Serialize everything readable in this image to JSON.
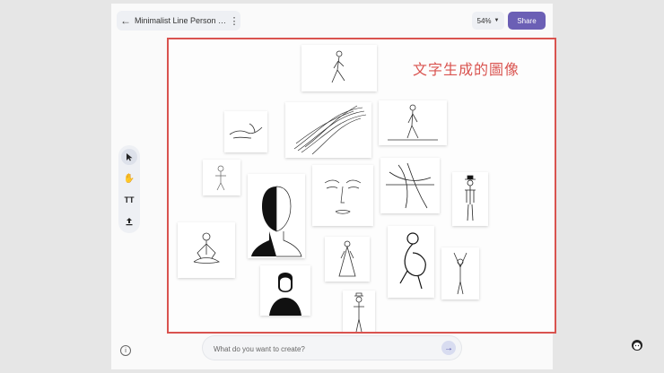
{
  "header": {
    "title": "Minimalist Line Person Dr...",
    "back_icon": "arrow-left-icon",
    "menu_icon": "kebab-menu-icon",
    "zoom_label": "54%",
    "share_label": "Share"
  },
  "toolbar": {
    "tools": [
      {
        "name": "select",
        "icon": "cursor-icon",
        "active": true
      },
      {
        "name": "hand",
        "icon": "hand-icon",
        "active": false
      },
      {
        "name": "text",
        "icon": "text-icon",
        "label": "TT",
        "active": false
      },
      {
        "name": "upload",
        "icon": "upload-icon",
        "active": false
      }
    ]
  },
  "canvas": {
    "annotation": "文字生成的圖像",
    "annotation_color": "#d9534f",
    "images": [
      {
        "subject": "walking-person-sketch"
      },
      {
        "subject": "abstract-swirl-lines"
      },
      {
        "subject": "walking-man-sketch"
      },
      {
        "subject": "hands-line-art"
      },
      {
        "subject": "small-figure-sketch"
      },
      {
        "subject": "half-face-portrait"
      },
      {
        "subject": "face-line-art"
      },
      {
        "subject": "abstract-curves"
      },
      {
        "subject": "standing-man-hat"
      },
      {
        "subject": "meditating-person"
      },
      {
        "subject": "woman-in-dress"
      },
      {
        "subject": "seated-figure"
      },
      {
        "subject": "arms-raised-figure"
      },
      {
        "subject": "man-silhouette-portrait"
      },
      {
        "subject": "standing-figure-bottom"
      }
    ]
  },
  "prompt": {
    "placeholder": "What do you want to create?",
    "send_icon": "arrow-right-icon"
  },
  "footer": {
    "info_icon": "info-icon"
  },
  "colors": {
    "share_button": "#6b5fb5",
    "highlight_border": "#d9534f"
  }
}
